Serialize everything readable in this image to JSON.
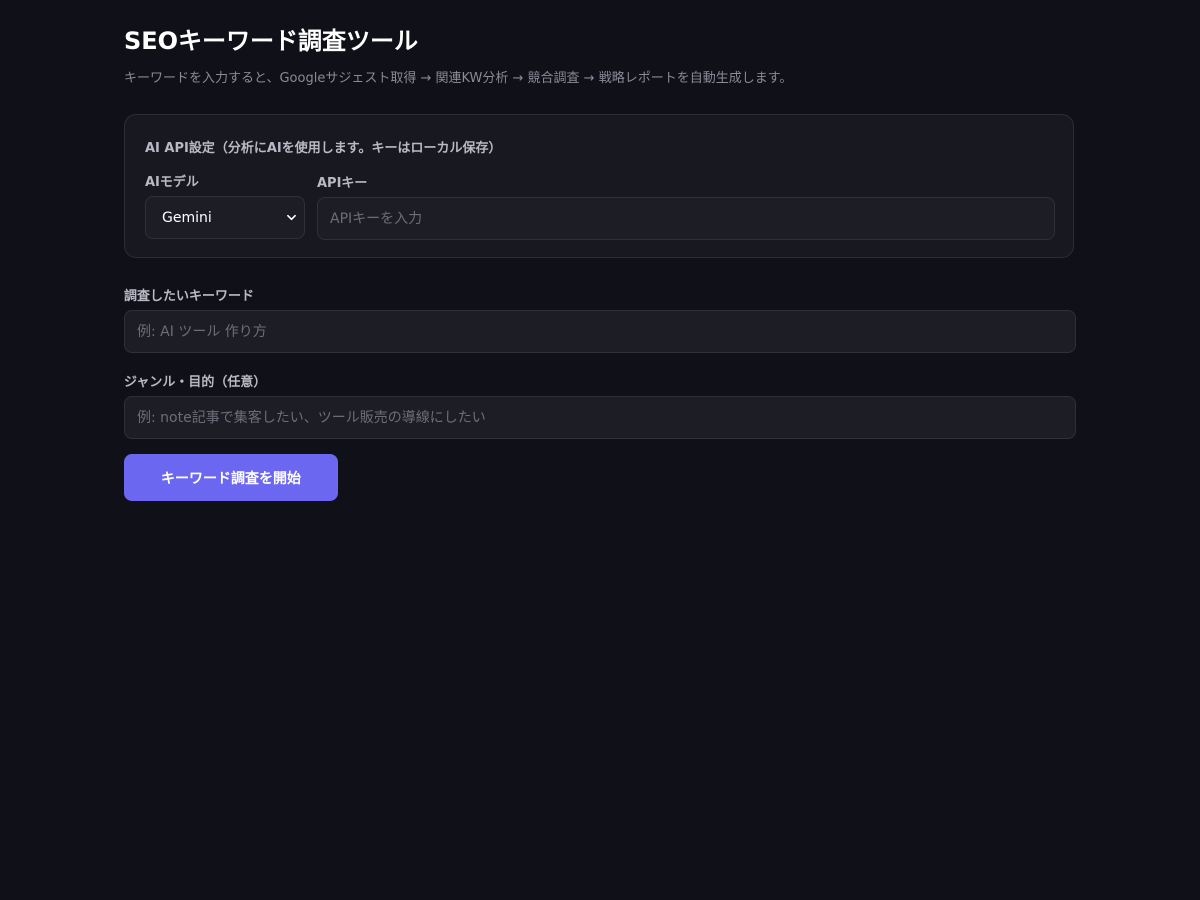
{
  "header": {
    "title": "SEOキーワード調査ツール",
    "subtitle": "キーワードを入力すると、Googleサジェスト取得 → 関連KW分析 → 競合調査 → 戦略レポートを自動生成します。"
  },
  "api_settings": {
    "title": "AI API設定（分析にAIを使用します。キーはローカル保存）",
    "model_label": "AIモデル",
    "model_value": "Gemini",
    "api_key_label": "APIキー",
    "api_key_placeholder": "APIキーを入力",
    "chevron_icon": "chevron-down-icon"
  },
  "form": {
    "keyword_label": "調査したいキーワード",
    "keyword_placeholder": "例: AI ツール 作り方",
    "genre_label": "ジャンル・目的（任意）",
    "genre_placeholder": "例: note記事で集客したい、ツール販売の導線にしたい",
    "start_button": "キーワード調査を開始"
  },
  "colors": {
    "background": "#101018",
    "card_background": "#181820",
    "input_background": "#1d1d26",
    "border": "#30303c",
    "accent": "#6c67f0",
    "muted_text": "#8a8a98"
  }
}
